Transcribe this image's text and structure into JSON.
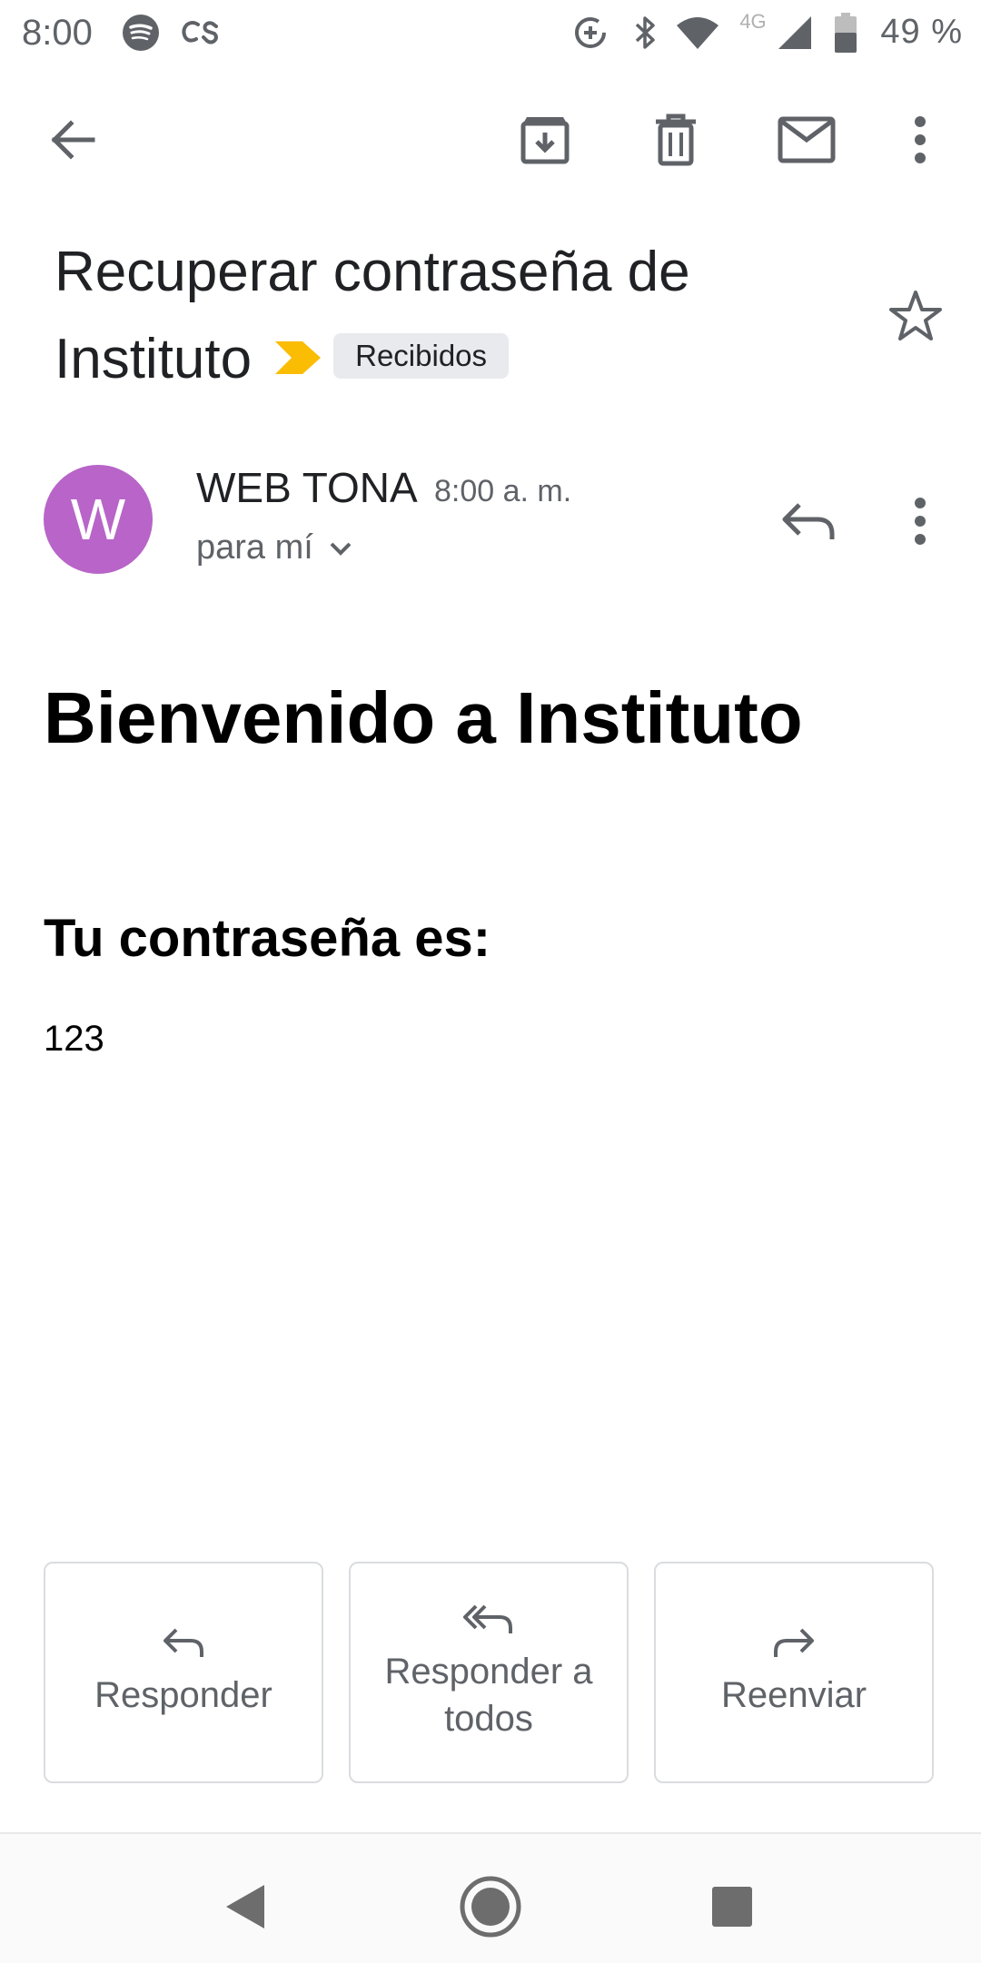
{
  "status_bar": {
    "time": "8:00",
    "battery": "49 %",
    "icons": [
      "spotify-icon",
      "lastfm-icon",
      "data-saver-icon",
      "bluetooth-icon",
      "wifi-icon",
      "lte-icon",
      "cell-signal-icon",
      "battery-icon"
    ],
    "network_label": "4G"
  },
  "toolbar": {
    "icons": [
      "back-arrow-icon",
      "archive-icon",
      "delete-icon",
      "mark-unread-icon",
      "more-vert-icon"
    ]
  },
  "email": {
    "subject": "Recuperar contraseña de Instituto",
    "label": "Recibidos",
    "sender": {
      "initial": "W",
      "name": "WEB TONA",
      "time": "8:00 a. m.",
      "recipient": "para mí"
    },
    "body": {
      "heading": "Bienvenido a Instituto",
      "subheading": "Tu contraseña es:",
      "value": "123"
    }
  },
  "actions": {
    "reply": "Responder",
    "reply_all": "Responder a todos",
    "forward": "Reenviar"
  },
  "colors": {
    "avatar": "#b864c8",
    "importance": "#fbbc04",
    "icon_gray": "#5f6368"
  }
}
